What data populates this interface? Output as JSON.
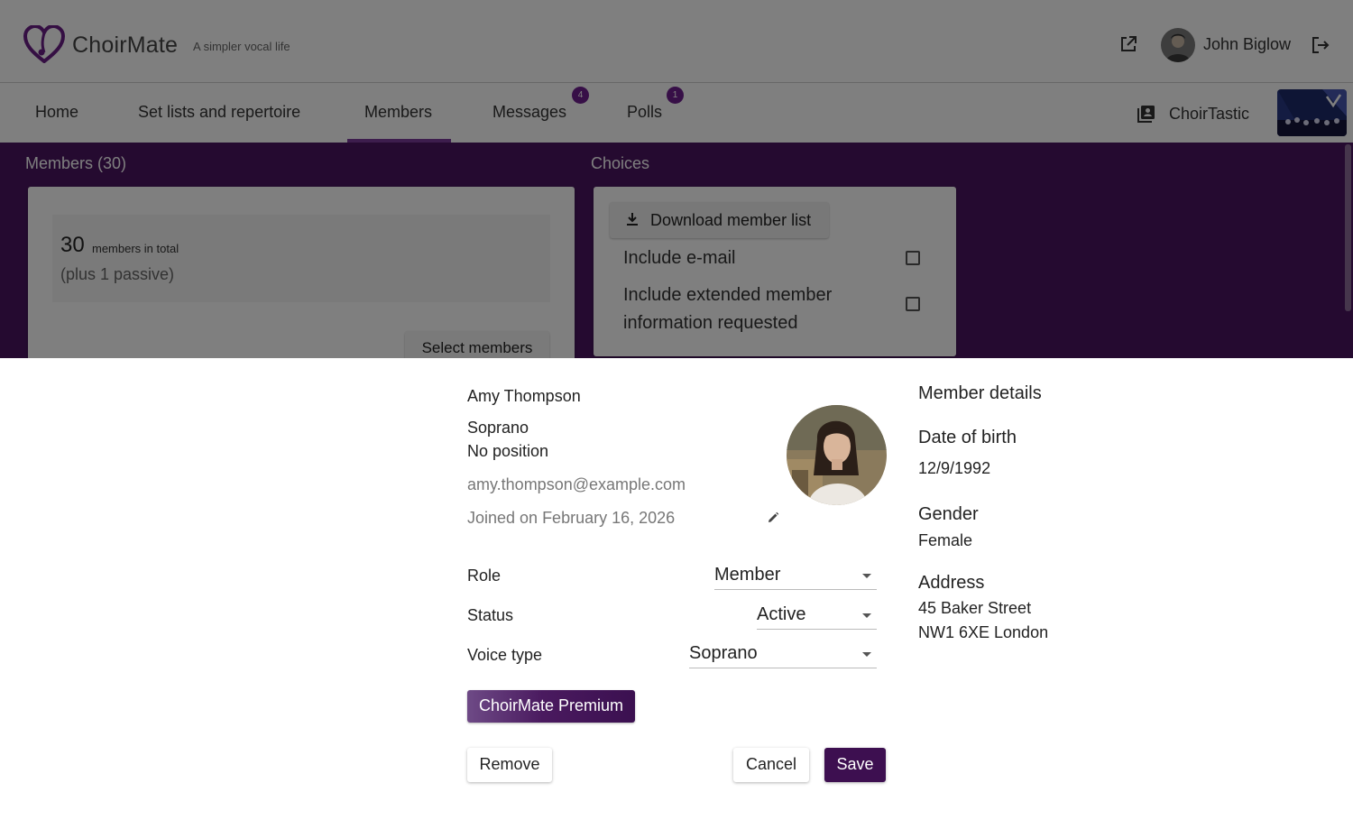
{
  "header": {
    "brand": "ChoirMate",
    "tagline": "A simpler vocal life",
    "user_name": "John Biglow",
    "icons": [
      "external-link-icon",
      "user-avatar",
      "logout-icon"
    ]
  },
  "nav": {
    "items": [
      {
        "label": "Home"
      },
      {
        "label": "Set lists and repertoire"
      },
      {
        "label": "Members",
        "active": true
      },
      {
        "label": "Messages",
        "badge": "4"
      },
      {
        "label": "Polls",
        "badge": "1"
      }
    ],
    "choir_name": "ChoirTastic"
  },
  "members_section": {
    "title": "Members (30)",
    "count": "30",
    "count_label": "members in total",
    "passive": "(plus 1 passive)",
    "select_button": "Select members"
  },
  "choices_section": {
    "title": "Choices",
    "download_button": "Download member list",
    "options": [
      {
        "label": "Include e-mail",
        "checked": false
      },
      {
        "label": "Include extended member information requested",
        "checked": false
      }
    ]
  },
  "member": {
    "name": "Amy Thompson",
    "voice": "Soprano",
    "position": "No position",
    "email": "amy.thompson@example.com",
    "joined": "Joined on February 16, 2026"
  },
  "form": {
    "role_label": "Role",
    "role_value": "Member",
    "status_label": "Status",
    "status_value": "Active",
    "voice_label": "Voice type",
    "voice_value": "Soprano",
    "premium_button": "ChoirMate Premium",
    "remove_button": "Remove",
    "cancel_button": "Cancel",
    "save_button": "Save"
  },
  "details": {
    "title": "Member details",
    "dob_label": "Date of birth",
    "dob_value": "12/9/1992",
    "gender_label": "Gender",
    "gender_value": "Female",
    "address_label": "Address",
    "address_line1": "45 Baker Street",
    "address_line2": "NW1 6XE London"
  },
  "colors": {
    "brand_purple": "#4a1560",
    "save_button": "#3d0f50",
    "badge": "#6e1f8e",
    "active_tab": "#7a3a9a"
  }
}
